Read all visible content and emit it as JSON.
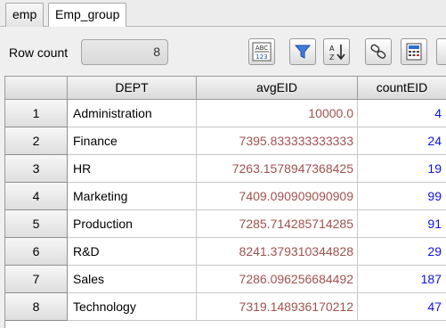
{
  "tabs": [
    {
      "label": "emp",
      "active": false
    },
    {
      "label": "Emp_group",
      "active": true
    }
  ],
  "toolbar": {
    "row_count_label": "Row count",
    "row_count_value": "8",
    "buttons": [
      {
        "name": "abc-123-format-icon"
      },
      {
        "name": "filter-icon"
      },
      {
        "name": "sort-az-icon"
      },
      {
        "name": "link-icon"
      },
      {
        "name": "calculator-icon"
      },
      {
        "name": "more-icon"
      }
    ]
  },
  "table": {
    "columns": [
      "DEPT",
      "avgEID",
      "countEID"
    ],
    "rows": [
      {
        "num": "1",
        "dept": "Administration",
        "avg": "10000.0",
        "count": "4"
      },
      {
        "num": "2",
        "dept": "Finance",
        "avg": "7395.833333333333",
        "count": "24"
      },
      {
        "num": "3",
        "dept": "HR",
        "avg": "7263.1578947368425",
        "count": "19"
      },
      {
        "num": "4",
        "dept": "Marketing",
        "avg": "7409.090909090909",
        "count": "99"
      },
      {
        "num": "5",
        "dept": "Production",
        "avg": "7285.714285714285",
        "count": "91"
      },
      {
        "num": "6",
        "dept": "R&D",
        "avg": "8241.379310344828",
        "count": "29"
      },
      {
        "num": "7",
        "dept": "Sales",
        "avg": "7286.096256684492",
        "count": "187"
      },
      {
        "num": "8",
        "dept": "Technology",
        "avg": "7319.148936170212",
        "count": "47"
      }
    ]
  },
  "colors": {
    "avg_text": "#a0524d",
    "count_text": "#1010e0"
  }
}
